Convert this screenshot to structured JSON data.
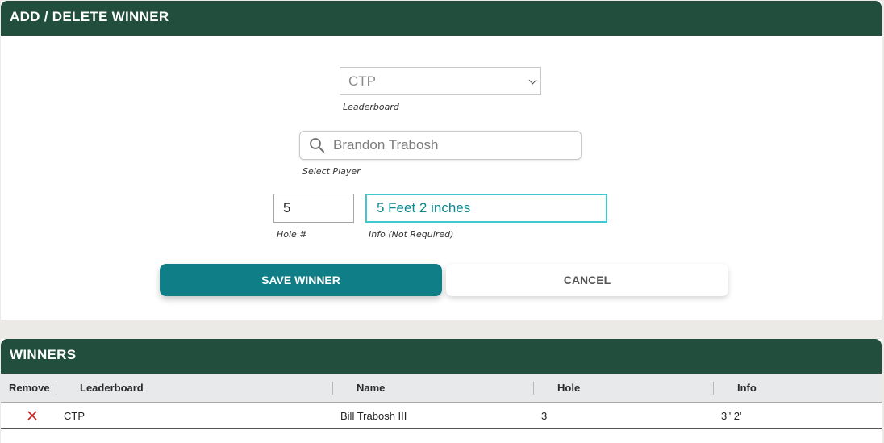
{
  "form_panel": {
    "title": "ADD / DELETE WINNER",
    "leaderboard_select": {
      "value": "CTP",
      "label": "Leaderboard"
    },
    "player_search": {
      "value": "Brandon Trabosh",
      "label": "Select Player"
    },
    "hole_input": {
      "value": "5",
      "label": "Hole #"
    },
    "info_input": {
      "value": "5 Feet 2 inches",
      "label": "Info (Not Required)"
    },
    "save_button": "SAVE WINNER",
    "cancel_button": "CANCEL"
  },
  "winners_panel": {
    "title": "WINNERS",
    "columns": [
      "Remove",
      "Leaderboard",
      "Name",
      "Hole",
      "Info"
    ],
    "rows": [
      {
        "leaderboard": "CTP",
        "name": "Bill Trabosh III",
        "hole": "3",
        "info": "3'' 2'"
      }
    ]
  },
  "icons": {
    "search": "search-icon",
    "remove": "remove-x-icon",
    "dropdown": "chevron-down-icon"
  },
  "colors": {
    "header_bg": "#224e3e",
    "primary_button": "#0f7e86",
    "focus_border": "#3fc8d0",
    "remove_icon": "#cc1f1f"
  }
}
